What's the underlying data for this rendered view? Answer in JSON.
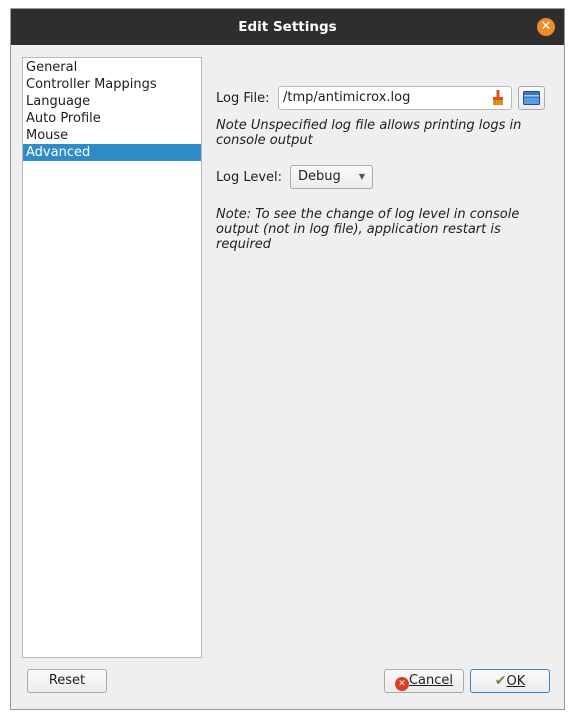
{
  "window": {
    "title": "Edit Settings",
    "close_icon": "close-icon"
  },
  "sidebar": {
    "items": [
      {
        "label": "General"
      },
      {
        "label": "Controller Mappings"
      },
      {
        "label": "Language"
      },
      {
        "label": "Auto Profile"
      },
      {
        "label": "Mouse"
      },
      {
        "label": "Advanced",
        "selected": true
      }
    ]
  },
  "advanced": {
    "log_file_label": "Log File:",
    "log_file_value": "/tmp/antimicrox.log",
    "log_file_note": "Note Unspecified log file allows printing logs in console output",
    "log_level_label": "Log Level:",
    "log_level_value": "Debug",
    "log_level_note": "Note: To see the change of log level in console output (not in log file), application restart is required"
  },
  "buttons": {
    "reset": "Reset",
    "cancel": "Cancel",
    "ok": "OK"
  },
  "colors": {
    "selection": "#308cc6",
    "titlebar": "#2e2e2e",
    "close": "#f08a24"
  }
}
